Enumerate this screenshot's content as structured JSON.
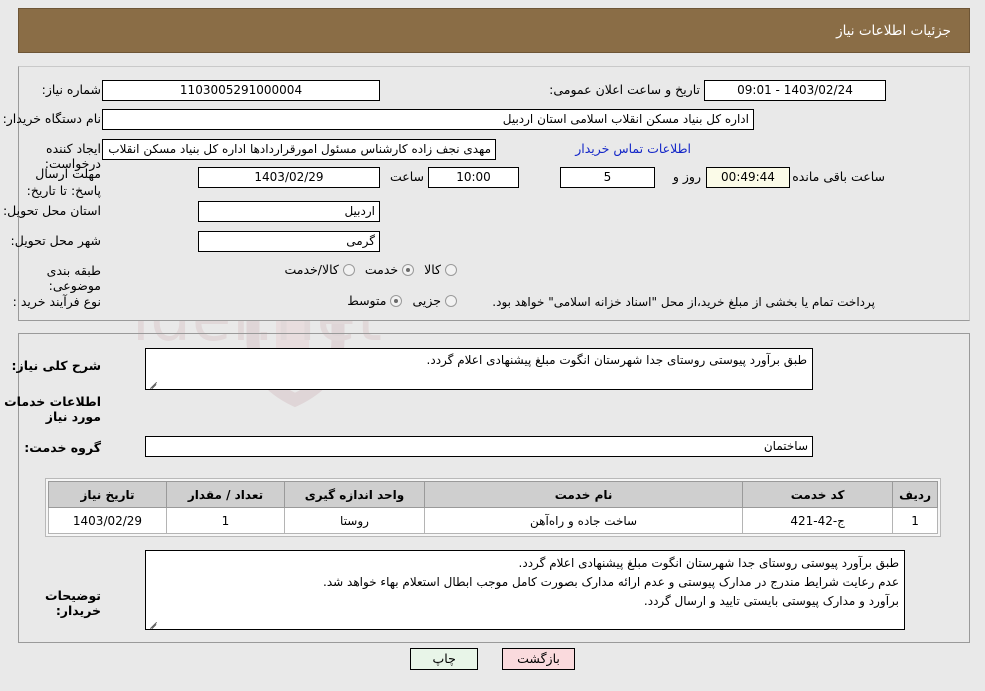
{
  "header": {
    "title": "جزئیات اطلاعات نیاز"
  },
  "fields": {
    "need_number_label": "شماره نیاز:",
    "need_number_value": "1103005291000004",
    "announce_label": "تاریخ و ساعت اعلان عمومی:",
    "announce_value": "1403/02/24 - 09:01",
    "buyer_org_label": "نام دستگاه خریدار:",
    "buyer_org_value": "اداره کل بنیاد مسکن انقلاب اسلامی استان اردبیل",
    "creator_label": "ایجاد کننده درخواست:",
    "creator_value": "مهدی نجف زاده کارشناس مسئول امورقراردادها اداره کل بنیاد مسکن انقلاب اس",
    "contact_link": "اطلاعات تماس خریدار",
    "deadline_label": "مهلت ارسال پاسخ: تا تاریخ:",
    "deadline_date": "1403/02/29",
    "hour_label": "ساعت",
    "deadline_hour": "10:00",
    "days_value": "5",
    "days_label": "روز و",
    "timer_value": "00:49:44",
    "timer_label": "ساعت باقی مانده",
    "province_label": "استان محل تحویل:",
    "province_value": "اردبیل",
    "city_label": "شهر محل تحویل:",
    "city_value": "گرمی",
    "category_label": "طبقه بندی موضوعی:",
    "process_label": "نوع فرآیند خرید :",
    "process_note": "پرداخت تمام یا بخشی از مبلغ خرید،از محل \"اسناد خزانه اسلامی\" خواهد بود."
  },
  "category_options": [
    {
      "label": "کالا",
      "selected": false
    },
    {
      "label": "خدمت",
      "selected": true
    },
    {
      "label": "کالا/خدمت",
      "selected": false
    }
  ],
  "process_options": [
    {
      "label": "جزیی",
      "selected": false
    },
    {
      "label": "متوسط",
      "selected": true
    }
  ],
  "description": {
    "label": "شرح کلی نیاز:",
    "value": "طبق برآورد پیوستی روستای جدا شهرستان انگوت مبلغ پیشنهادی اعلام گردد."
  },
  "services_section": {
    "heading": "اطلاعات خدمات مورد نیاز",
    "group_label": "گروه خدمت:",
    "group_value": "ساختمان"
  },
  "table": {
    "columns": [
      "ردیف",
      "کد خدمت",
      "نام خدمت",
      "واحد اندازه گیری",
      "تعداد / مقدار",
      "تاریخ نیاز"
    ],
    "rows": [
      {
        "row_no": "1",
        "service_code": "ج-42-421",
        "service_name": "ساخت جاده و راه‌آهن",
        "unit": "روستا",
        "quantity": "1",
        "need_date": "1403/02/29"
      }
    ]
  },
  "buyer_notes": {
    "label": "توضیحات خریدار:",
    "lines": [
      "طبق برآورد پیوستی روستای جدا شهرستان انگوت مبلغ پیشنهادی اعلام گردد.",
      "عدم رعایت شرایط مندرج در مدارک پیوستی و عدم ارائه مدارک بصورت کامل موجب ابطال استعلام بهاء خواهد شد.",
      "برآورد و مدارک پیوستی بایستی تایید و ارسال گردد."
    ]
  },
  "buttons": {
    "print": "چاپ",
    "back": "بازگشت"
  },
  "colors": {
    "header_bg": "#8a6d46",
    "link": "#1427c8",
    "table_header_bg": "#cfcfcf",
    "print_btn_bg": "#e8f5e8",
    "back_btn_bg": "#fadadd",
    "timer_bg": "#fbfbe8"
  },
  "watermark": {
    "text": "AriaTender.net"
  }
}
